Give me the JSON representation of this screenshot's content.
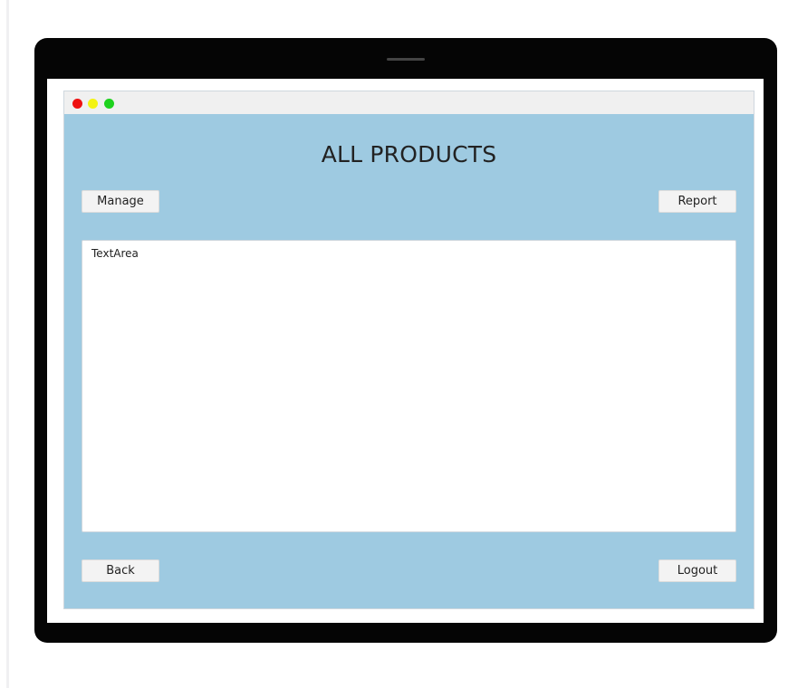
{
  "window": {
    "controls": [
      "close-dot",
      "minimize-dot",
      "maximize-dot"
    ],
    "colors": {
      "background": "#9ecae1",
      "titlebar": "#f0f0f0",
      "close": "#ee1111",
      "minimize": "#f3f313",
      "maximize": "#1ed21e"
    }
  },
  "header": {
    "title": "ALL PRODUCTS"
  },
  "toolbar": {
    "manage_label": "Manage",
    "report_label": "Report"
  },
  "main": {
    "textarea_text": "TextArea"
  },
  "footer": {
    "back_label": "Back",
    "logout_label": "Logout"
  }
}
